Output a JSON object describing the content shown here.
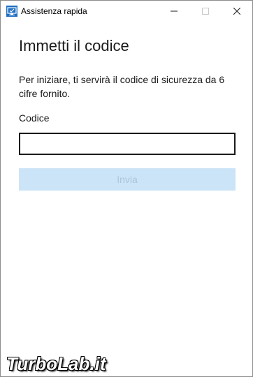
{
  "window": {
    "title": "Assistenza rapida",
    "app_icon": "quick-assist-icon",
    "controls": {
      "minimize_icon": "minimize-icon",
      "maximize_icon": "maximize-icon",
      "close_icon": "close-icon"
    }
  },
  "main": {
    "heading": "Immetti il codice",
    "description": "Per iniziare, ti servirà il codice di sicurezza da 6 cifre fornito.",
    "code_label": "Codice",
    "code_value": "",
    "code_placeholder": "",
    "submit_label": "Invia",
    "submit_disabled": true
  },
  "watermark": {
    "text": "TurboLab.it"
  },
  "colors": {
    "accent_disabled": "#cce4f7",
    "accent_disabled_text": "#a9c5de",
    "text": "#1a1a1a"
  }
}
